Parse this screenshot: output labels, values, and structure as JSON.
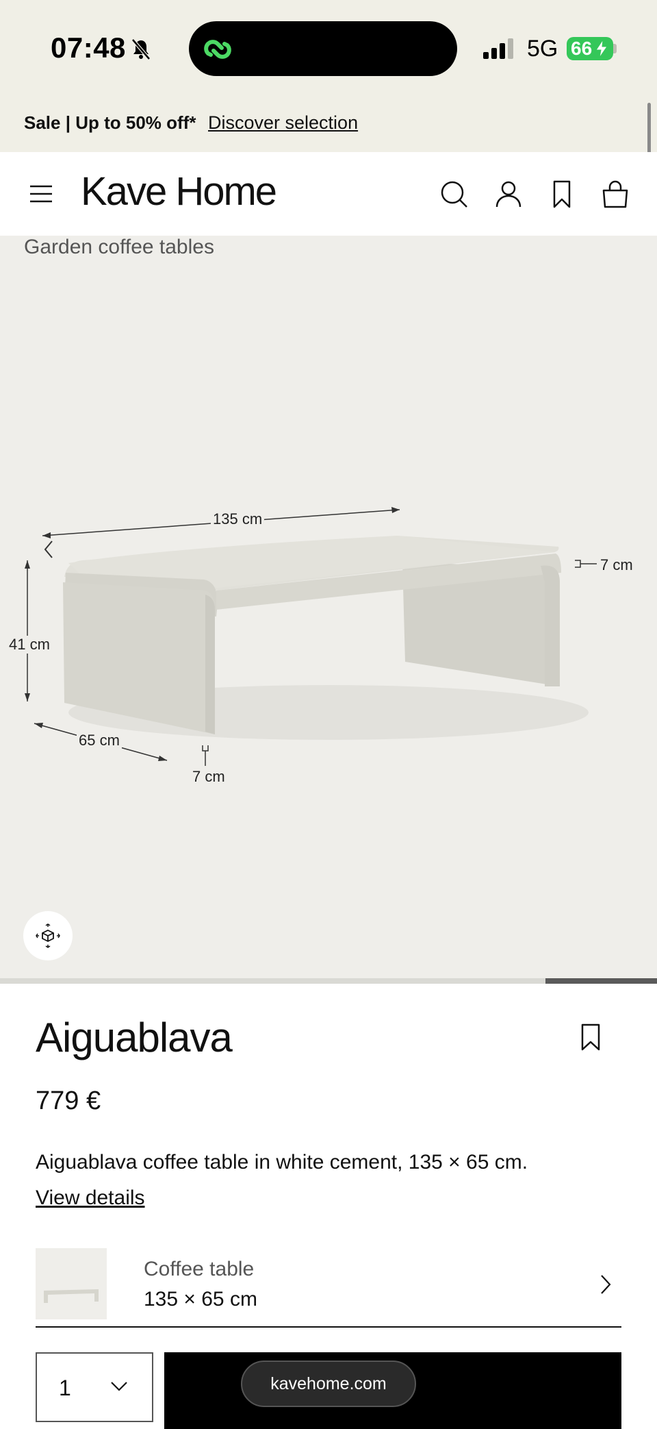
{
  "status_bar": {
    "time": "07:48",
    "network": "5G",
    "battery": "66",
    "icons": [
      "bell-slash-icon",
      "app-link-icon",
      "signal-icon",
      "battery-charging-icon"
    ]
  },
  "promo": {
    "text": "Sale | Up to 50% off*",
    "link": "Discover selection"
  },
  "header": {
    "logo": "Kave Home",
    "icons": [
      "menu-icon",
      "search-icon",
      "account-icon",
      "bookmark-icon",
      "bag-icon"
    ]
  },
  "gallery": {
    "breadcrumb": "Garden coffee tables",
    "dimensions": {
      "width": "135 cm",
      "height": "41 cm",
      "depth": "65 cm",
      "thickness_side": "7 cm",
      "thickness_bottom": "7 cm"
    },
    "image_progress": 0.17,
    "colors": {
      "background": "#efeeea",
      "table": "#d9d8d0"
    }
  },
  "product": {
    "title": "Aiguablava",
    "price": "779 €",
    "description": "Aiguablava coffee table in white cement, 135 × 65 cm.",
    "details_link": "View details",
    "variant": {
      "label": "Coffee table",
      "size": "135 × 65 cm"
    },
    "quantity": "1"
  },
  "browser": {
    "url": "kavehome.com"
  }
}
